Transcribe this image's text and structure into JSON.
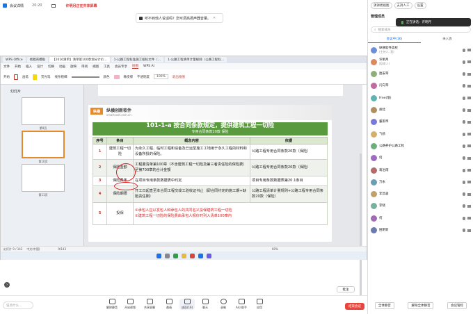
{
  "meeting": {
    "app": "会议详情",
    "time": "20:20",
    "recording": "许明月正在共享屏幕",
    "speaking_hint": "听不到他人说话吗？您可调高扬声器音量。"
  },
  "wps": {
    "tabs": [
      "WPS Office",
      "找稿壳模板",
      "【2016清单】清单第100章划分计价…",
      "1-公路工程标准施工招标文件（…",
      "1-公路工程清单计量规则（公路工程标…"
    ],
    "menu": [
      "文件",
      "开始",
      "插入",
      "设计",
      "切换",
      "动画",
      "放映",
      "审阅",
      "视图",
      "工具",
      "会员专享",
      "WPS AI"
    ],
    "menu_selected": "绘图",
    "toolbar": [
      "开始",
      "画笔",
      "荧光笔",
      "线条粗细",
      "颜色",
      "橡皮擦",
      "不透明度",
      "100%",
      "退出绘图"
    ],
    "panel_title": "幻灯片",
    "thumb_labels": [
      "第9页",
      "第10页",
      "第11页"
    ],
    "status": [
      "幻灯片 9 / 143",
      "中文(中国)",
      "9/143",
      "60%"
    ]
  },
  "slide": {
    "brand": "纵横创新软件",
    "brand_url": "smartcost.com.cn",
    "title": "101-1-a 按合同条款规定，提供建筑工程一切险",
    "subtitle": "专用合同条款20款 保险",
    "headers": [
      "序号",
      "条目",
      "概念内容",
      "依据"
    ],
    "rows": [
      {
        "num": "1",
        "item": "建筑工程一切险",
        "content": "为永久工程、临时工程和设备及已运至施工工地用于永久工程的材料和设备所投的保险。",
        "basis": "公路工程专用合同条款20款（保险）"
      },
      {
        "num": "2",
        "item": "保险金额",
        "content": "工程量清单第100章（不含建筑工程一切险及第三者责任险的保险费）至第700章的合计金额",
        "basis": "公路工程专用合同条款20款（保险）"
      },
      {
        "num": "3",
        "item": "保险费率",
        "content": "在项目专用条款数据表中约定",
        "basis": "项目专用条款数据表第20.1条目"
      },
      {
        "num": "4",
        "item": "保险期限",
        "content": "开工日起直至本合同工程交竣工验收证书止（即合同约定的施工期+缺陷责任期）",
        "basis": "公路工程清单计量规则+公路工程专用合同条款20款（保险）"
      },
      {
        "num": "5",
        "item": "投保",
        "content": "①承包人应以发包人和承包人的共同名义投保建筑工程一切险\n②建筑工程一切险的保险费由承包人报价时列入清单100章内",
        "basis": ""
      }
    ],
    "comment": "批注"
  },
  "panel": {
    "top_buttons": [
      "演讲者视图",
      "支持人工",
      "设置"
    ],
    "title": "管理成员",
    "speaking_now": "正在讲话：许明月",
    "search": "搜索成员",
    "tabs": [
      "会议中(16)",
      "未入会"
    ],
    "members": [
      {
        "name": "纵横软件高校",
        "sub": "(主持人, 我)"
      },
      {
        "name": "许明月",
        "sub": "(联席人)"
      },
      {
        "name": "唐安琴",
        "sub": ""
      },
      {
        "name": "闫向琴",
        "sub": ""
      },
      {
        "name": "Free(落)",
        "sub": ""
      },
      {
        "name": "胡佳",
        "sub": ""
      },
      {
        "name": "董雨帝",
        "sub": ""
      },
      {
        "name": "飞扬",
        "sub": ""
      },
      {
        "name": "公路养护公路工程",
        "sub": ""
      },
      {
        "name": "何",
        "sub": ""
      },
      {
        "name": "蒋治雨",
        "sub": ""
      },
      {
        "name": "万永",
        "sub": ""
      },
      {
        "name": "李昌森",
        "sub": ""
      },
      {
        "name": "李晓",
        "sub": ""
      },
      {
        "name": "何",
        "sub": ""
      },
      {
        "name": "田明新",
        "sub": ""
      }
    ],
    "bottom": [
      "全体静音",
      "解除全体静音",
      "会议管控"
    ]
  },
  "toolbar": {
    "chat_placeholder": "说点什么…",
    "items": [
      "解除静音",
      "开启视频",
      "共享屏幕",
      "邀请",
      "成员(16)",
      "聊天",
      "录制",
      "AI小助手",
      "应用"
    ],
    "end": "结束会议"
  }
}
